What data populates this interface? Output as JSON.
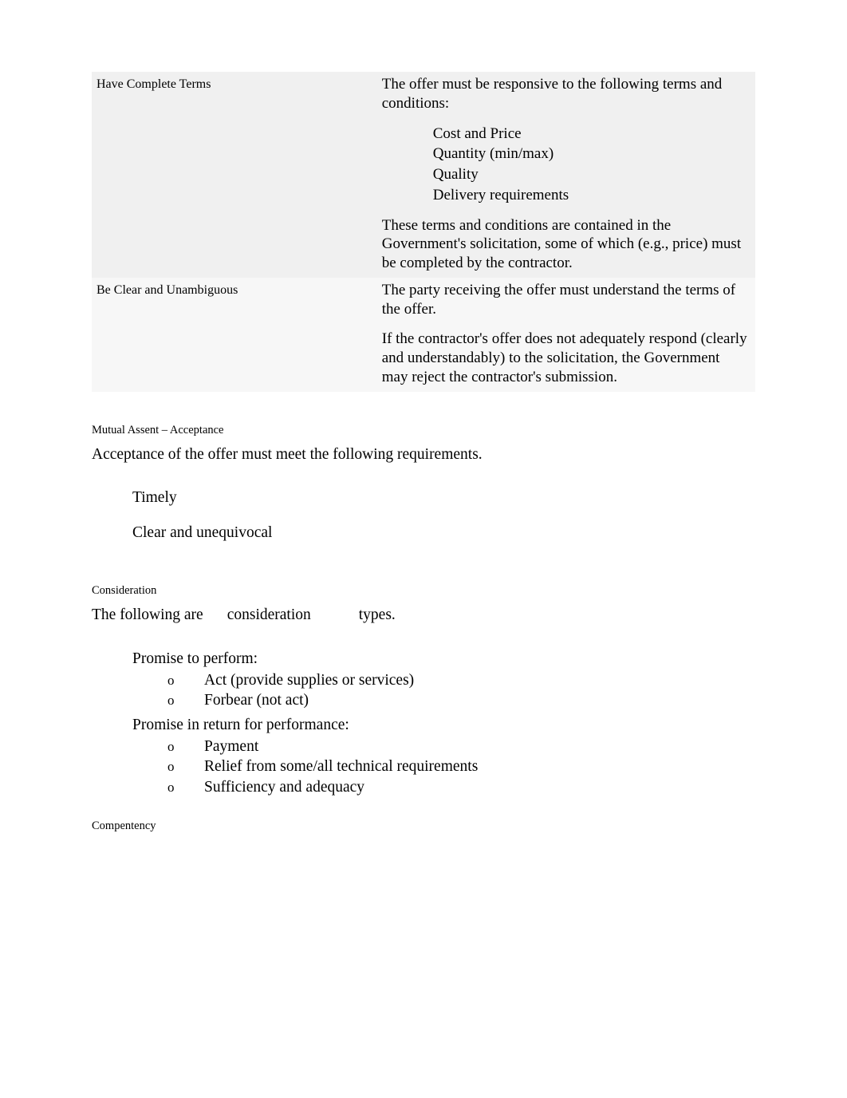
{
  "table": {
    "rows": [
      {
        "left": "Have Complete Terms",
        "right_intro": "The offer must be responsive to the following terms and conditions:",
        "right_bullets": [
          "Cost and Price",
          "Quantity (min/max)",
          "Quality",
          "Delivery requirements"
        ],
        "right_outro": "These terms and conditions are contained in the Government's solicitation, some of which (e.g., price) must be completed by the contractor."
      },
      {
        "left": "Be Clear and Unambiguous",
        "right_p1": "The party receiving the offer must understand the terms of the offer.",
        "right_p2": "If the contractor's offer does not adequately respond (clearly and understandably) to the solicitation, the Government may reject the contractor's submission."
      }
    ]
  },
  "glyphs": {
    "box": "",
    "o": "o"
  },
  "section_assent": {
    "heading": "Mutual Assent – Acceptance",
    "intro": "Acceptance of the offer must meet the following requirements.",
    "items": [
      "Timely",
      "Clear and unequivocal"
    ]
  },
  "section_consideration": {
    "heading": "Consideration",
    "intro_pre": "The following are",
    "intro_mid": "consideration",
    "intro_post": "types.",
    "items": [
      {
        "label": "Promise to perform:",
        "subs": [
          "Act (provide supplies or services)",
          "Forbear (not act)"
        ]
      },
      {
        "label": "Promise in return for performance:",
        "subs": [
          "Payment",
          "Relief from some/all technical requirements",
          "Sufficiency and adequacy"
        ]
      }
    ]
  },
  "section_competency": {
    "heading": "Compentency"
  }
}
